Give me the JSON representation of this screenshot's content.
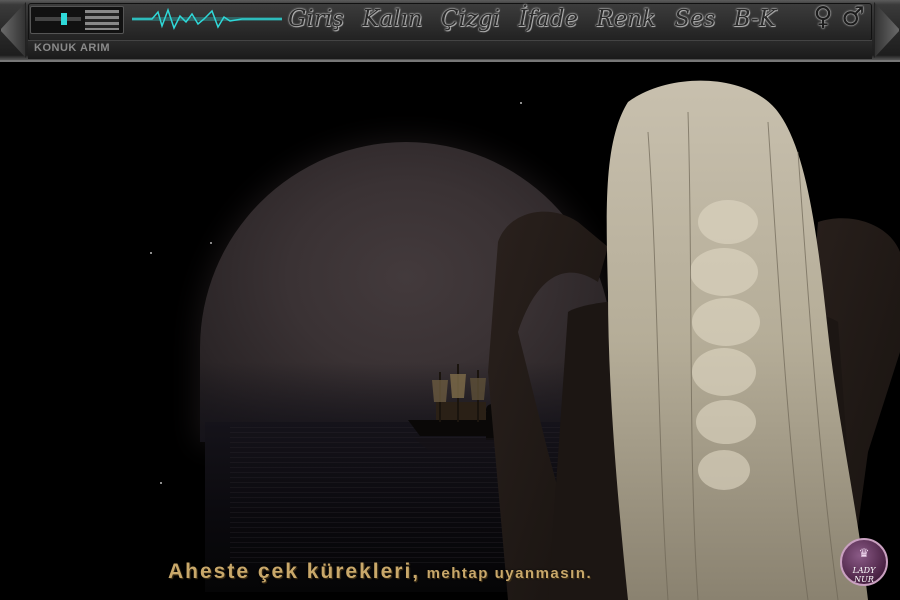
{
  "toolbar": {
    "room_label": "KONUK ARIM",
    "menu": [
      "Giriş",
      "Kalın",
      "Çizgi",
      "İfade",
      "Renk",
      "Ses",
      "B-K"
    ],
    "female_symbol": "♀",
    "male_symbol": "♂",
    "icons": {
      "left": "left-arrow-icon",
      "right": "right-arrow-icon",
      "mixer": "mixer-icon",
      "pulse": "heartbeat-icon"
    }
  },
  "scene": {
    "caption_main": "Aheste çek kürekleri,",
    "caption_small": "mehtap uyanmasın."
  },
  "badge": {
    "crown": "♛",
    "text": "LADY NUR"
  },
  "colors": {
    "accent": "#2fd9d9",
    "caption": "#c9a86a",
    "moon": "#3a3234",
    "badge": "#6a3a66"
  }
}
